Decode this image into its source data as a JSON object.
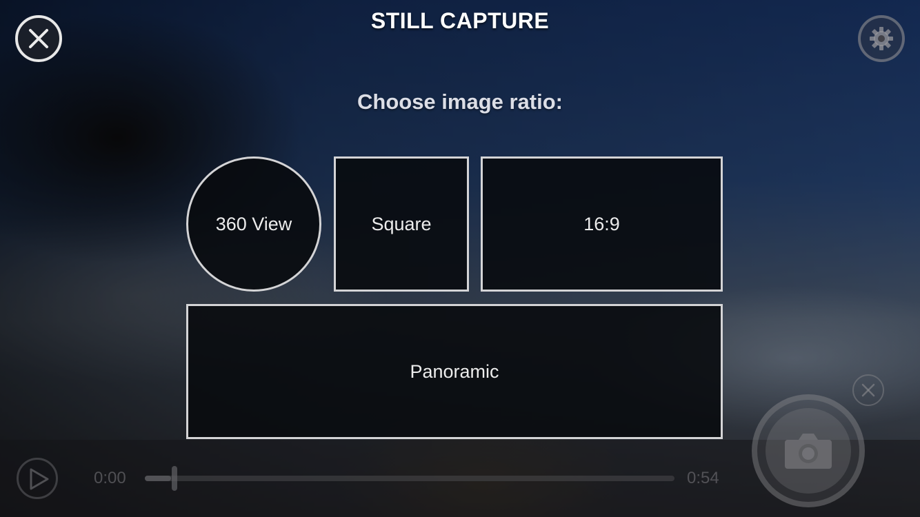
{
  "header": {
    "title": "STILL CAPTURE",
    "close_icon": "close-icon",
    "settings_icon": "gear-icon"
  },
  "prompt": "Choose image ratio:",
  "ratio_options": [
    {
      "label": "360 View",
      "shape": "circle"
    },
    {
      "label": "Square",
      "shape": "square"
    },
    {
      "label": "16:9",
      "shape": "rectangle"
    },
    {
      "label": "Panoramic",
      "shape": "wide-rectangle"
    }
  ],
  "playback": {
    "play_icon": "play-icon",
    "current_time": "0:00",
    "total_time": "0:54",
    "progress_fraction": 0.05
  },
  "capture": {
    "shutter_icon": "camera-icon",
    "dismiss_icon": "close-icon"
  },
  "colors": {
    "option_border": "#d4d4d6",
    "option_fill": "#080a0e",
    "title_text": "#ffffff",
    "sky_blue": "#1d3d78"
  }
}
